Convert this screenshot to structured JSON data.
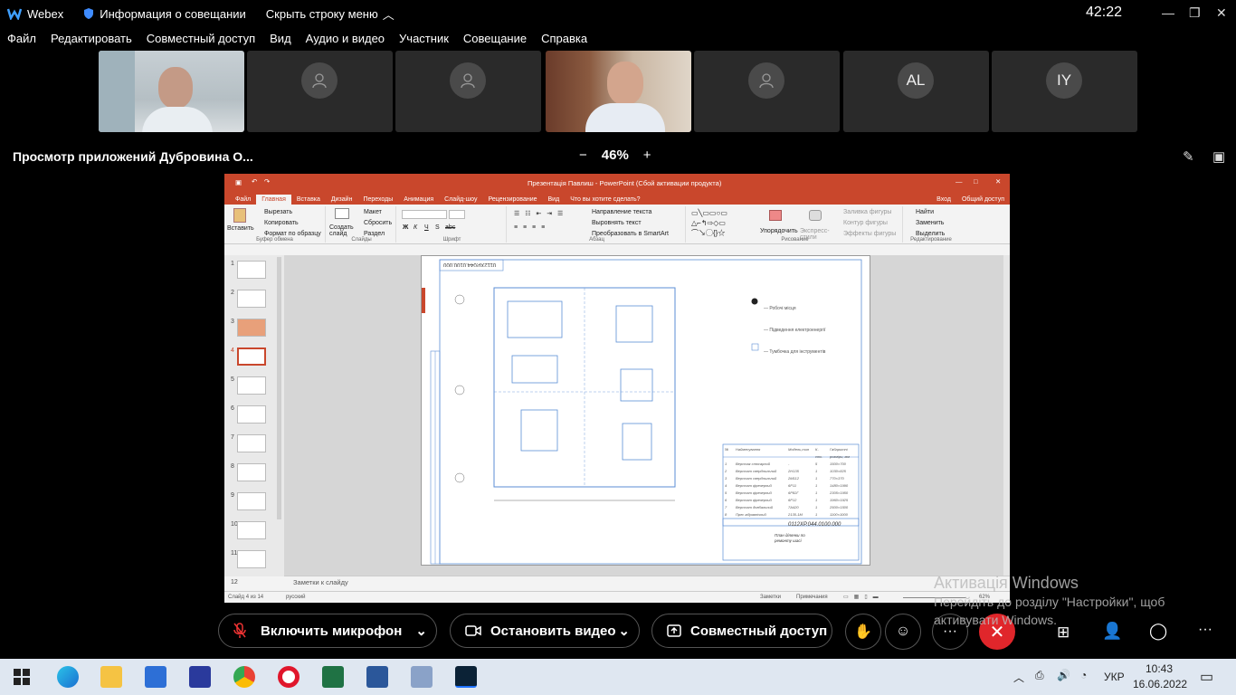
{
  "titlebar": {
    "app_name": "Webex",
    "meeting_info": "Информация о совещании",
    "hide_menu": "Скрыть строку меню",
    "timer": "42:22"
  },
  "menu": {
    "items": [
      "Файл",
      "Редактировать",
      "Совместный доступ",
      "Вид",
      "Аудио и видео",
      "Участник",
      "Совещание",
      "Справка"
    ]
  },
  "participants": [
    {
      "type": "video"
    },
    {
      "type": "placeholder"
    },
    {
      "type": "placeholder"
    },
    {
      "type": "video"
    },
    {
      "type": "placeholder"
    },
    {
      "type": "initials",
      "initials": "AL"
    },
    {
      "type": "initials",
      "initials": "IY"
    }
  ],
  "viewbar": {
    "title": "Просмотр приложений Дубровина О...",
    "zoom_minus": "−",
    "zoom_level": "46%",
    "zoom_plus": "+"
  },
  "powerpoint": {
    "title": "Презентація Павлиш - PowerPoint (Сбой активации продукта)",
    "tabs": [
      "Файл",
      "Главная",
      "Вставка",
      "Дизайн",
      "Переходы",
      "Анимация",
      "Слайд-шоу",
      "Рецензирование",
      "Вид",
      "Что вы хотите сделать?"
    ],
    "right_tabs": [
      "Вход",
      "Общий доступ"
    ],
    "ribbon": {
      "clipboard": {
        "paste": "Вставить",
        "cut": "Вырезать",
        "copy": "Копировать",
        "format": "Формат по образцу",
        "label": "Буфер обмена"
      },
      "slides": {
        "create": "Создать слайд",
        "layout": "Макет",
        "reset": "Сбросить",
        "section": "Раздел",
        "label": "Слайды"
      },
      "font": {
        "label": "Шрифт",
        "bold": "Ж",
        "italic": "К",
        "underline": "Ч",
        "strike": "S",
        "abc": "abc"
      },
      "paragraph": {
        "direction": "Направление текста",
        "align": "Выровнять текст",
        "smartart": "Преобразовать в SmartArt",
        "label": "Абзац"
      },
      "drawing": {
        "arrange": "Упорядочить",
        "styles": "Экспресс-стили",
        "fill": "Заливка фигуры",
        "outline": "Контур фигуры",
        "effects": "Эффекты фигуры",
        "label": "Рисование"
      },
      "editing": {
        "find": "Найти",
        "replace": "Заменить",
        "select": "Выделить",
        "label": "Редактирование"
      }
    },
    "thumbnails": [
      "1",
      "2",
      "3",
      "4",
      "5",
      "6",
      "7",
      "8",
      "9",
      "10",
      "11",
      "12"
    ],
    "active_thumb": 3,
    "slide": {
      "stamp": "0112ХР.044.0100.000",
      "title_block": "0112ХР.044.0100.000",
      "legend": [
        "— Робочі місця",
        "— Підведення електроенергії",
        "— Тумбочка для інструментів"
      ],
      "table_header": [
        "№",
        "Найменування",
        "Модель,тип",
        "К-сть",
        "Габаритні розміри, мм"
      ],
      "table_rows": [
        [
          "1",
          "Верстак слюсарний",
          "-",
          "5",
          "1500×700"
        ],
        [
          "2",
          "Верстат свердлильний",
          "2Н135",
          "1",
          "1030×825"
        ],
        [
          "3",
          "Верстат свердлильний",
          "2М112",
          "1",
          "770×370"
        ],
        [
          "4",
          "Верстат фрезерний",
          "6Р11",
          "1",
          "1480×1990"
        ],
        [
          "5",
          "Верстат фрезерний",
          "6Р82Г",
          "1",
          "2305×1950"
        ],
        [
          "6",
          "Верстат фрезерний",
          "6Р12",
          "1",
          "1960×1925"
        ],
        [
          "7",
          "Верстат довбальний",
          "7А420",
          "1",
          "2500×1500"
        ],
        [
          "8",
          "Прес гідравлічний",
          "2135-1М",
          "1",
          "1100×1000"
        ]
      ],
      "plan_label": "План ділянки по ремонту шасі"
    },
    "notes": "Заметки к слайду",
    "status": {
      "slide_num": "Слайд 4 из 14",
      "lang": "русский",
      "notes": "Заметки",
      "comments": "Примечания",
      "zoom": "62%"
    }
  },
  "controls": {
    "mic": "Включить микрофон",
    "video": "Остановить видео",
    "share": "Совместный доступ"
  },
  "activation": {
    "title": "Активація Windows",
    "line1": "Перейдіть до розділу \"Настройки\", щоб",
    "line2": "активувати Windows."
  },
  "taskbar": {
    "lang": "УКР",
    "time": "10:43",
    "date": "16.06.2022"
  },
  "colors": {
    "ppt_accent": "#c9472c",
    "end_call": "#e0262b",
    "webex_blue": "#1e73ff"
  }
}
